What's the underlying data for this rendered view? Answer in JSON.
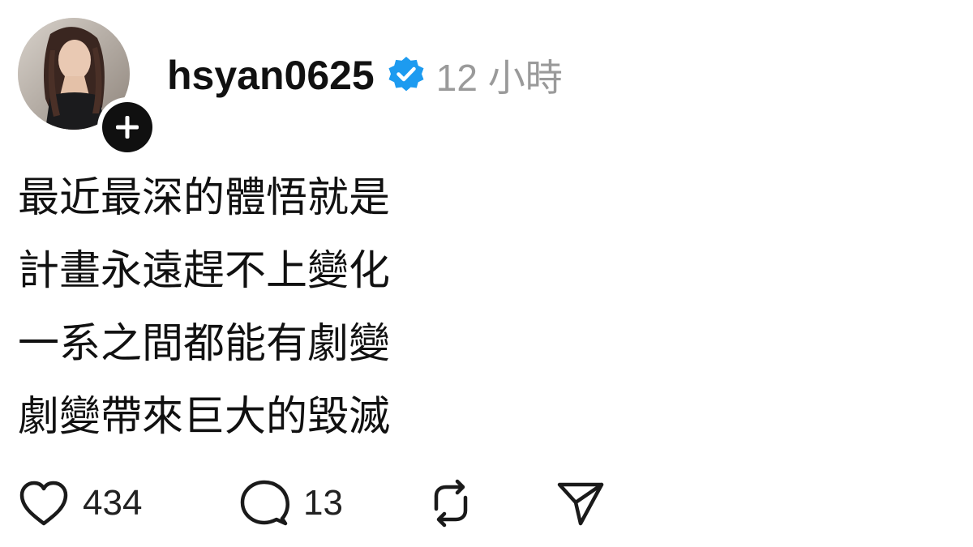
{
  "post": {
    "username": "hsyan0625",
    "timestamp": "12 小時",
    "verified": true,
    "lines": [
      "最近最深的體悟就是",
      "計畫永遠趕不上變化",
      "一系之間都能有劇變",
      "劇變帶來巨大的毀滅"
    ]
  },
  "actions": {
    "likes": "434",
    "replies": "13"
  },
  "icons": {
    "avatar": "avatar-photo",
    "follow": "plus-icon",
    "verified": "verified-badge-icon",
    "like": "heart-icon",
    "reply": "speech-bubble-icon",
    "repost": "repost-icon",
    "share": "paper-plane-icon"
  },
  "colors": {
    "verified": "#1d9bf0",
    "text": "#111111",
    "timestamp": "#9a9a9a"
  }
}
